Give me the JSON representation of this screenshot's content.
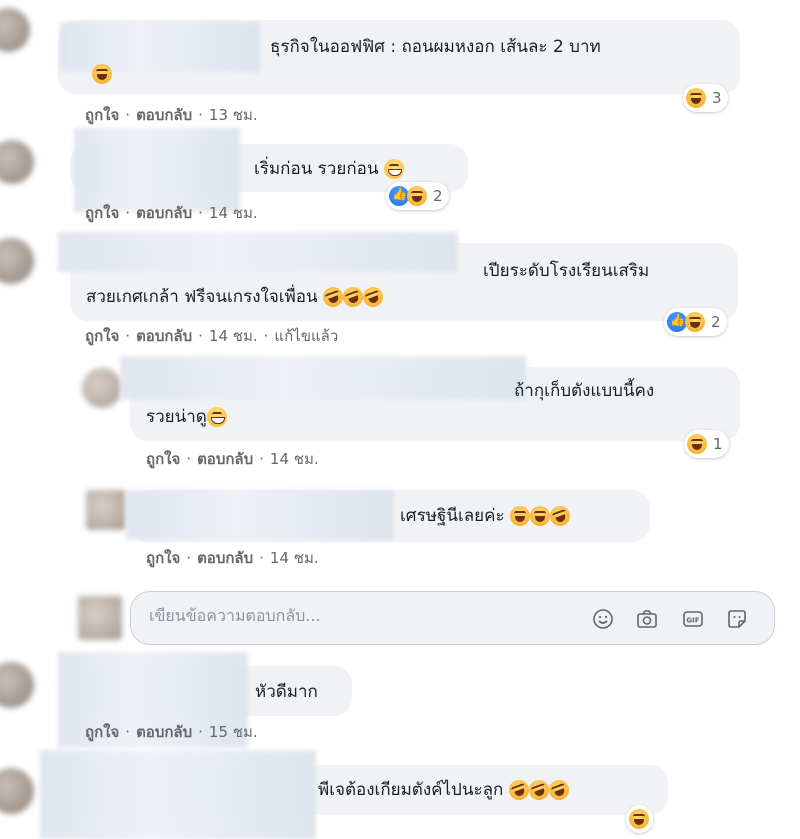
{
  "comments": [
    {
      "text": "ธุรกิจในออฟฟิศ : ถอนผมหงอก เส้นละ 2 บาท",
      "like": "ถูกใจ",
      "reply": "ตอบกลับ",
      "time": "13 ชม.",
      "reaction_count": "3"
    },
    {
      "text": "เริ่มก่อน รวยก่อน",
      "like": "ถูกใจ",
      "reply": "ตอบกลับ",
      "time": "14 ชม.",
      "reaction_count": "2"
    },
    {
      "text_line1": "เปียระดับโรงเรียนเสริม",
      "text_line2": "สวยเกศเกล้า ฟรีจนเกรงใจเพื่อน",
      "like": "ถูกใจ",
      "reply": "ตอบกลับ",
      "time": "14 ชม.",
      "edited": "แก้ไขแล้ว",
      "reaction_count": "2"
    },
    {
      "text_line1": "ถ้ากุเก็บตังแบบนี้คง",
      "text_line2": "รวยน่าดู",
      "like": "ถูกใจ",
      "reply": "ตอบกลับ",
      "time": "14 ชม.",
      "reaction_count": "1"
    },
    {
      "text": "เศรษฐินีเลยค่ะ",
      "like": "ถูกใจ",
      "reply": "ตอบกลับ",
      "time": "14 ชม."
    },
    {
      "text": "หัวดีมาก",
      "like": "ถูกใจ",
      "reply": "ตอบกลับ",
      "time": "15 ชม."
    },
    {
      "text": "พีเจต้องเกียมตังค์ไปนะลูก"
    }
  ],
  "reply_box": {
    "placeholder": "เขียนข้อความตอบกลับ..."
  },
  "icons": [
    "smiley-icon",
    "camera-icon",
    "gif-icon",
    "sticker-icon"
  ],
  "colors": {
    "bubble": "#f0f2f5",
    "meta": "#65676b",
    "like_blue": "#1877f2"
  }
}
